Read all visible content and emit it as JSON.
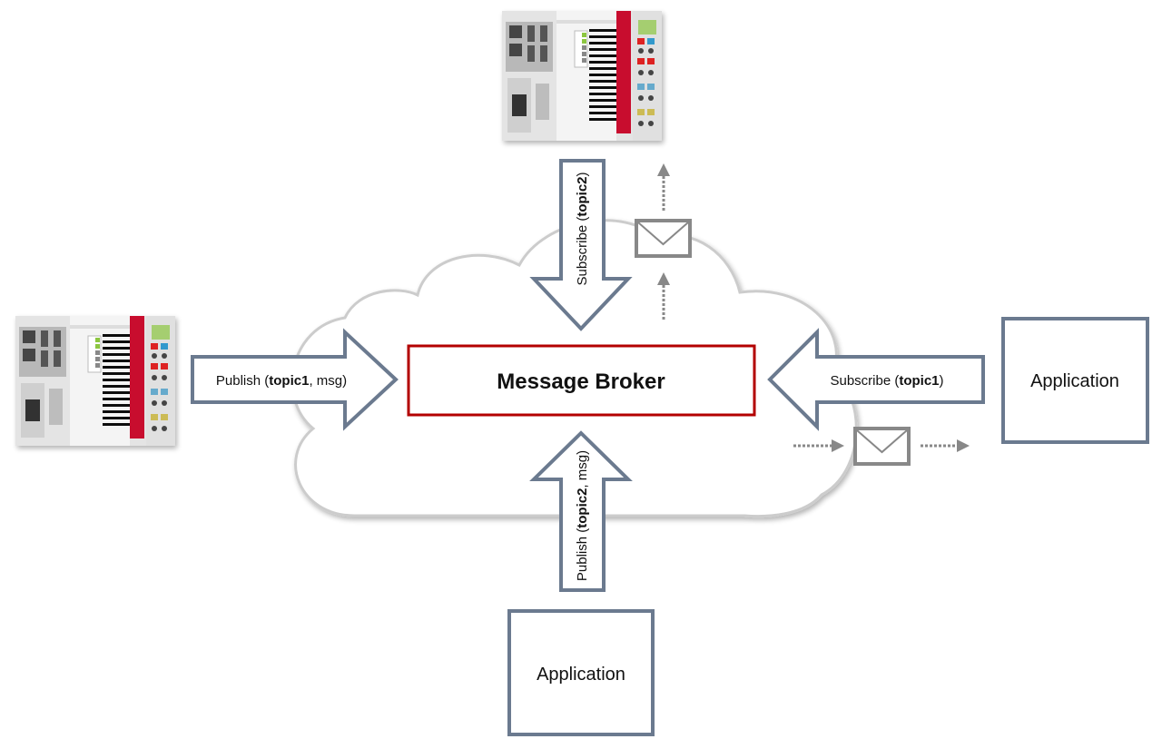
{
  "colors": {
    "arrow": "#6b7a8f",
    "broker_border": "#b30000",
    "envelope": "#888888",
    "cloud_border": "#cccccc",
    "plc_red": "#c8102e"
  },
  "broker": {
    "label": "Message Broker"
  },
  "publish_left": {
    "prefix": "Publish (",
    "topic": "topic1",
    "suffix": ", msg)"
  },
  "subscribe_top": {
    "prefix": "Subscribe (",
    "topic": "topic2",
    "suffix": ")"
  },
  "subscribe_right": {
    "prefix": "Subscribe (",
    "topic": "topic1",
    "suffix": ")"
  },
  "publish_bottom": {
    "prefix": "Publish (",
    "topic": "topic2",
    "suffix": ", msg)"
  },
  "app_right": {
    "label": "Application"
  },
  "app_bottom": {
    "label": "Application"
  },
  "icons": [
    "plc-device",
    "envelope-icon",
    "cloud"
  ]
}
